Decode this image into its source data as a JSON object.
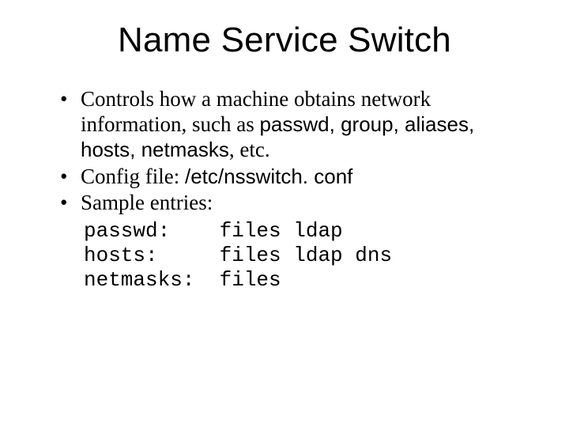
{
  "title": "Name Service Switch",
  "bullets": {
    "b1": {
      "t1": "Controls how a machine obtains network information, such as ",
      "code": "passwd, group, aliases, hosts, netmasks",
      "t2": ", etc."
    },
    "b2": {
      "t1": "Config file: ",
      "code": "/etc/nsswitch. conf"
    },
    "b3": {
      "t1": "Sample entries:"
    }
  },
  "sample": "passwd:    files ldap\nhosts:     files ldap dns\nnetmasks:  files"
}
